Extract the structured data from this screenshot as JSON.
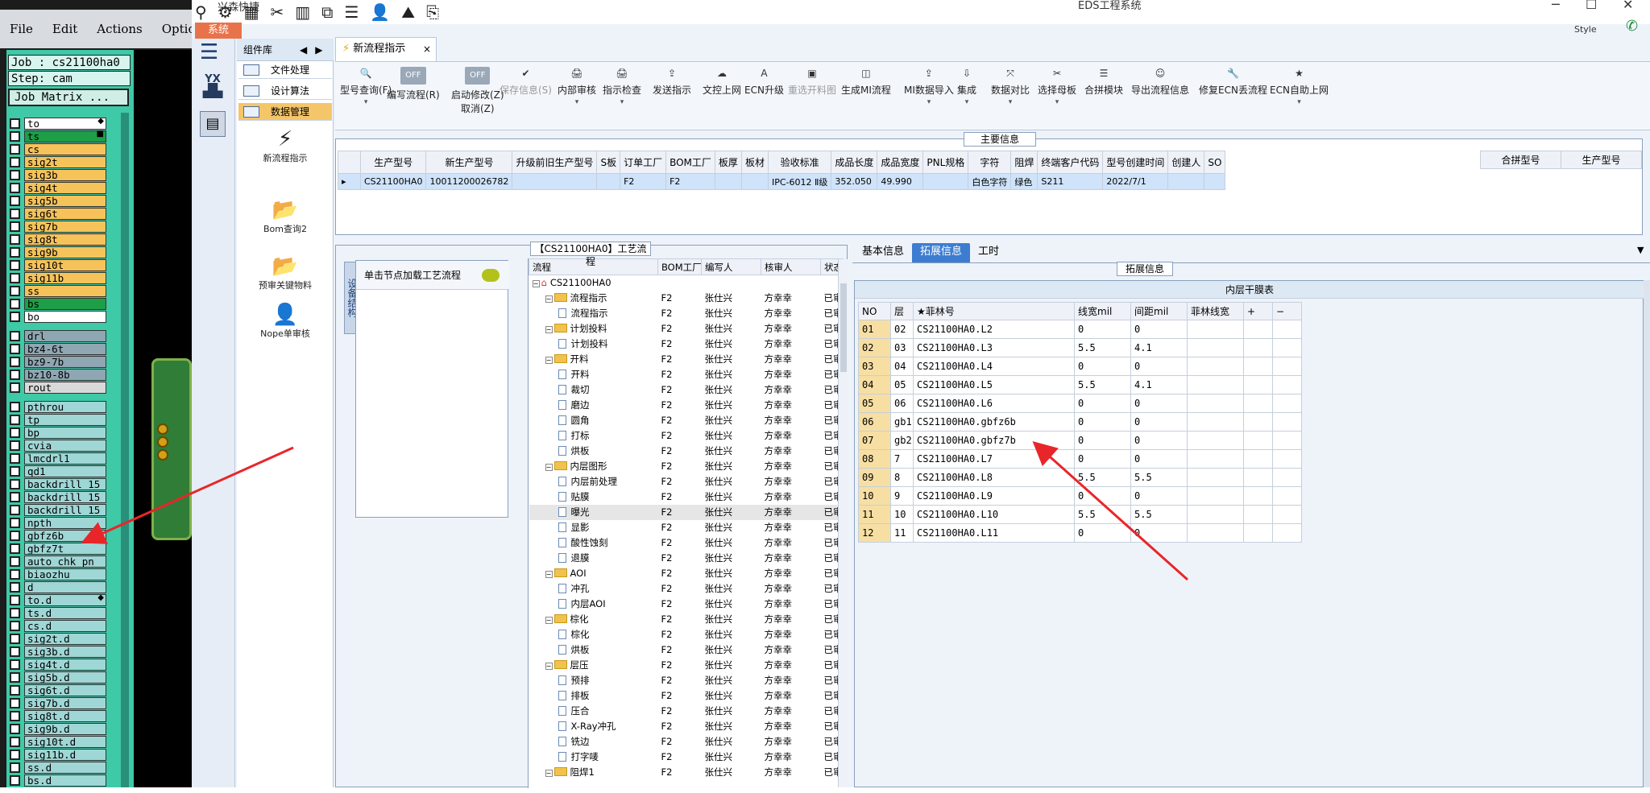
{
  "cam": {
    "menu": [
      "File",
      "Edit",
      "Actions",
      "Options"
    ],
    "job_line": "Job : cs21100ha0",
    "step_line": "Step: cam",
    "matrix_button": "Job Matrix ...",
    "layers_a": [
      {
        "name": "to",
        "color": "#ffffff",
        "mark": "◆"
      },
      {
        "name": "ts",
        "color": "#1e9e46",
        "mark": "■"
      },
      {
        "name": "cs",
        "color": "#f5c35a"
      },
      {
        "name": "sig2t",
        "color": "#f5c35a"
      },
      {
        "name": "sig3b",
        "color": "#f5c35a"
      },
      {
        "name": "sig4t",
        "color": "#f5c35a"
      },
      {
        "name": "sig5b",
        "color": "#f5c35a"
      },
      {
        "name": "sig6t",
        "color": "#f5c35a"
      },
      {
        "name": "sig7b",
        "color": "#f5c35a"
      },
      {
        "name": "sig8t",
        "color": "#f5c35a"
      },
      {
        "name": "sig9b",
        "color": "#f5c35a"
      },
      {
        "name": "sig10t",
        "color": "#f5c35a"
      },
      {
        "name": "sig11b",
        "color": "#f5c35a"
      },
      {
        "name": "ss",
        "color": "#f5c35a"
      },
      {
        "name": "bs",
        "color": "#1e9e46"
      },
      {
        "name": "bo",
        "color": "#ffffff"
      }
    ],
    "layers_b": [
      {
        "name": "drl",
        "color": "#8fa6b3"
      },
      {
        "name": "bz4-6t",
        "color": "#8fa6b3"
      },
      {
        "name": "bz9-7b",
        "color": "#8fa6b3"
      },
      {
        "name": "bz10-8b",
        "color": "#8fa6b3"
      },
      {
        "name": "rout",
        "color": "#d9d9d9"
      }
    ],
    "layers_c": [
      {
        "name": "pthrou",
        "color": "#9fd6d6"
      },
      {
        "name": "tp",
        "color": "#9fd6d6"
      },
      {
        "name": "bp",
        "color": "#9fd6d6"
      },
      {
        "name": "cvia",
        "color": "#9fd6d6"
      },
      {
        "name": "lmcdrl1",
        "color": "#9fd6d6"
      },
      {
        "name": "qd1",
        "color": "#9fd6d6"
      },
      {
        "name": "backdrill_15",
        "color": "#9fd6d6"
      },
      {
        "name": "backdrill_15",
        "color": "#9fd6d6"
      },
      {
        "name": "backdrill_15",
        "color": "#9fd6d6"
      },
      {
        "name": "npth",
        "color": "#9fd6d6"
      },
      {
        "name": "gbfz6b",
        "color": "#9fd6d6"
      },
      {
        "name": "gbfz7t",
        "color": "#9fd6d6"
      },
      {
        "name": "auto_chk_pn",
        "color": "#9fd6d6"
      },
      {
        "name": "biaozhu",
        "color": "#9fd6d6"
      },
      {
        "name": "d",
        "color": "#9fd6d6"
      },
      {
        "name": "to.d",
        "color": "#9fd6d6",
        "mark": "◆"
      },
      {
        "name": "ts.d",
        "color": "#9fd6d6"
      },
      {
        "name": "cs.d",
        "color": "#9fd6d6"
      },
      {
        "name": "sig2t.d",
        "color": "#9fd6d6"
      },
      {
        "name": "sig3b.d",
        "color": "#9fd6d6"
      },
      {
        "name": "sig4t.d",
        "color": "#9fd6d6"
      },
      {
        "name": "sig5b.d",
        "color": "#9fd6d6"
      },
      {
        "name": "sig6t.d",
        "color": "#9fd6d6"
      },
      {
        "name": "sig7b.d",
        "color": "#9fd6d6"
      },
      {
        "name": "sig8t.d",
        "color": "#9fd6d6"
      },
      {
        "name": "sig9b.d",
        "color": "#9fd6d6"
      },
      {
        "name": "sig10t.d",
        "color": "#9fd6d6"
      },
      {
        "name": "sig11b.d",
        "color": "#9fd6d6"
      },
      {
        "name": "ss.d",
        "color": "#9fd6d6"
      },
      {
        "name": "bs.d",
        "color": "#9fd6d6"
      }
    ]
  },
  "window": {
    "title": "EDS工程系统",
    "quick_name": "兴森快捷",
    "system_tab": "系统",
    "style_label": "Style"
  },
  "nav": {
    "logo_text": "YX",
    "component_header": "组件库",
    "items": [
      {
        "label": "文件处理",
        "selected": false
      },
      {
        "label": "设计算法",
        "selected": false
      },
      {
        "label": "数据管理",
        "selected": true
      }
    ],
    "big_icons": [
      {
        "label": "新流程指示",
        "icon": "⚡"
      },
      {
        "label": "Bom查询2",
        "icon": "📂"
      },
      {
        "label": "预审关键物料",
        "icon": "📂"
      },
      {
        "label": "Nope单审核",
        "icon": "👤"
      }
    ]
  },
  "ribbon": {
    "tab_label": "新流程指示",
    "close": "×",
    "toggle_off": "OFF",
    "buttons": [
      {
        "label": "型号查询(F)",
        "icon": "🔍",
        "dd": true,
        "disabled": false
      },
      {
        "label": "编写流程(R)",
        "icon": "",
        "dd": false,
        "disabled": false,
        "toggle": true
      },
      {
        "label": "启动修改(Z)",
        "label2": "取消(Z)",
        "icon": "",
        "dd": false,
        "disabled": false,
        "toggle": true
      },
      {
        "label": "保存信息(S)",
        "icon": "✔",
        "dd": false,
        "disabled": true
      },
      {
        "label": "内部审核",
        "icon": "🖨",
        "dd": true,
        "disabled": false
      },
      {
        "label": "指示检查",
        "icon": "🖨",
        "dd": true,
        "disabled": false
      },
      {
        "label": "发送指示",
        "icon": "⇪",
        "dd": false,
        "disabled": false
      },
      {
        "label": "文控上网",
        "icon": "☁",
        "dd": false,
        "disabled": false
      },
      {
        "label": "ECN升级",
        "icon": "A",
        "dd": false,
        "disabled": false
      },
      {
        "label": "重选开料图",
        "icon": "▣",
        "dd": false,
        "disabled": true
      },
      {
        "label": "生成MI流程",
        "icon": "◫",
        "dd": false,
        "disabled": false
      },
      {
        "label": "MI数据导入",
        "icon": "⇪",
        "dd": true,
        "disabled": false
      },
      {
        "label": "集成",
        "icon": "⇩",
        "dd": true,
        "disabled": false
      },
      {
        "label": "数据对比",
        "icon": "⤧",
        "dd": true,
        "disabled": false
      },
      {
        "label": "选择母板",
        "icon": "✂",
        "dd": true,
        "disabled": false
      },
      {
        "label": "合拼模块",
        "icon": "☰",
        "dd": false,
        "disabled": false
      },
      {
        "label": "导出流程信息",
        "icon": "☺",
        "dd": false,
        "disabled": false
      },
      {
        "label": "修复ECN丢流程",
        "icon": "🔧",
        "dd": false,
        "disabled": false
      },
      {
        "label": "ECN自助上网",
        "icon": "★",
        "dd": true,
        "disabled": false
      }
    ]
  },
  "main_info": {
    "title": "主要信息",
    "columns": [
      "生产型号",
      "新生产型号",
      "升级前旧生产型号",
      "S板",
      "订单工厂",
      "BOM工厂",
      "板厚",
      "板材",
      "验收标准",
      "成品长度",
      "成品宽度",
      "PNL规格",
      "字符",
      "阻焊",
      "终端客户代码",
      "型号创建时间",
      "创建人",
      "SO"
    ],
    "row": [
      "CS21100HA0",
      "10011200026782",
      "",
      "",
      "F2",
      "F2",
      "",
      "",
      "IPC-6012 Ⅱ级",
      "352.050",
      "49.990",
      "",
      "白色字符",
      "绿色",
      "S211",
      "2022/7/1",
      "",
      ""
    ],
    "merge_columns": [
      "合拼型号",
      "生产型号"
    ]
  },
  "process": {
    "title": "【CS21100HA0】工艺流程",
    "vertical_tab": "设备结构",
    "node_header": "单击节点加载工艺流程",
    "columns": [
      "流程",
      "BOM工厂",
      "编写人",
      "核审人",
      "状态"
    ],
    "rows": [
      {
        "level": 0,
        "type": "root",
        "name": "CS21100HA0",
        "bom": "",
        "writer": "",
        "reviewer": "",
        "status": ""
      },
      {
        "level": 1,
        "type": "folder",
        "name": "流程指示",
        "bom": "F2",
        "writer": "张仕兴",
        "reviewer": "方幸幸",
        "status": "已审核"
      },
      {
        "level": 2,
        "type": "doc",
        "name": "流程指示",
        "bom": "F2",
        "writer": "张仕兴",
        "reviewer": "方幸幸",
        "status": "已审核"
      },
      {
        "level": 1,
        "type": "folder",
        "name": "计划投料",
        "bom": "F2",
        "writer": "张仕兴",
        "reviewer": "方幸幸",
        "status": "已审核"
      },
      {
        "level": 2,
        "type": "doc",
        "name": "计划投料",
        "bom": "F2",
        "writer": "张仕兴",
        "reviewer": "方幸幸",
        "status": "已审核"
      },
      {
        "level": 1,
        "type": "folder",
        "name": "开料",
        "bom": "F2",
        "writer": "张仕兴",
        "reviewer": "方幸幸",
        "status": "已审核"
      },
      {
        "level": 2,
        "type": "doc",
        "name": "开料",
        "bom": "F2",
        "writer": "张仕兴",
        "reviewer": "方幸幸",
        "status": "已审核"
      },
      {
        "level": 2,
        "type": "doc",
        "name": "裁切",
        "bom": "F2",
        "writer": "张仕兴",
        "reviewer": "方幸幸",
        "status": "已审核"
      },
      {
        "level": 2,
        "type": "doc",
        "name": "磨边",
        "bom": "F2",
        "writer": "张仕兴",
        "reviewer": "方幸幸",
        "status": "已审核"
      },
      {
        "level": 2,
        "type": "doc",
        "name": "圆角",
        "bom": "F2",
        "writer": "张仕兴",
        "reviewer": "方幸幸",
        "status": "已审核"
      },
      {
        "level": 2,
        "type": "doc",
        "name": "打标",
        "bom": "F2",
        "writer": "张仕兴",
        "reviewer": "方幸幸",
        "status": "已审核"
      },
      {
        "level": 2,
        "type": "doc",
        "name": "烘板",
        "bom": "F2",
        "writer": "张仕兴",
        "reviewer": "方幸幸",
        "status": "已审核"
      },
      {
        "level": 1,
        "type": "folder",
        "name": "内层图形",
        "bom": "F2",
        "writer": "张仕兴",
        "reviewer": "方幸幸",
        "status": "已审核"
      },
      {
        "level": 2,
        "type": "doc",
        "name": "内层前处理",
        "bom": "F2",
        "writer": "张仕兴",
        "reviewer": "方幸幸",
        "status": "已审核"
      },
      {
        "level": 2,
        "type": "doc",
        "name": "贴膜",
        "bom": "F2",
        "writer": "张仕兴",
        "reviewer": "方幸幸",
        "status": "已审核"
      },
      {
        "level": 2,
        "type": "doc",
        "name": "曝光",
        "bom": "F2",
        "writer": "张仕兴",
        "reviewer": "方幸幸",
        "status": "已审核",
        "hl": true
      },
      {
        "level": 2,
        "type": "doc",
        "name": "显影",
        "bom": "F2",
        "writer": "张仕兴",
        "reviewer": "方幸幸",
        "status": "已审核"
      },
      {
        "level": 2,
        "type": "doc",
        "name": "酸性蚀刻",
        "bom": "F2",
        "writer": "张仕兴",
        "reviewer": "方幸幸",
        "status": "已审核"
      },
      {
        "level": 2,
        "type": "doc",
        "name": "退膜",
        "bom": "F2",
        "writer": "张仕兴",
        "reviewer": "方幸幸",
        "status": "已审核"
      },
      {
        "level": 1,
        "type": "folder",
        "name": "AOI",
        "bom": "F2",
        "writer": "张仕兴",
        "reviewer": "方幸幸",
        "status": "已审核"
      },
      {
        "level": 2,
        "type": "doc",
        "name": "冲孔",
        "bom": "F2",
        "writer": "张仕兴",
        "reviewer": "方幸幸",
        "status": "已审核"
      },
      {
        "level": 2,
        "type": "doc",
        "name": "内层AOI",
        "bom": "F2",
        "writer": "张仕兴",
        "reviewer": "方幸幸",
        "status": "已审核"
      },
      {
        "level": 1,
        "type": "folder",
        "name": "棕化",
        "bom": "F2",
        "writer": "张仕兴",
        "reviewer": "方幸幸",
        "status": "已审核"
      },
      {
        "level": 2,
        "type": "doc",
        "name": "棕化",
        "bom": "F2",
        "writer": "张仕兴",
        "reviewer": "方幸幸",
        "status": "已审核"
      },
      {
        "level": 2,
        "type": "doc",
        "name": "烘板",
        "bom": "F2",
        "writer": "张仕兴",
        "reviewer": "方幸幸",
        "status": "已审核"
      },
      {
        "level": 1,
        "type": "folder",
        "name": "层压",
        "bom": "F2",
        "writer": "张仕兴",
        "reviewer": "方幸幸",
        "status": "已审核"
      },
      {
        "level": 2,
        "type": "doc",
        "name": "预排",
        "bom": "F2",
        "writer": "张仕兴",
        "reviewer": "方幸幸",
        "status": "已审核"
      },
      {
        "level": 2,
        "type": "doc",
        "name": "排板",
        "bom": "F2",
        "writer": "张仕兴",
        "reviewer": "方幸幸",
        "status": "已审核"
      },
      {
        "level": 2,
        "type": "doc",
        "name": "压合",
        "bom": "F2",
        "writer": "张仕兴",
        "reviewer": "方幸幸",
        "status": "已审核"
      },
      {
        "level": 2,
        "type": "doc",
        "name": "X-Ray冲孔",
        "bom": "F2",
        "writer": "张仕兴",
        "reviewer": "方幸幸",
        "status": "已审核"
      },
      {
        "level": 2,
        "type": "doc",
        "name": "铣边",
        "bom": "F2",
        "writer": "张仕兴",
        "reviewer": "方幸幸",
        "status": "已审核"
      },
      {
        "level": 2,
        "type": "doc",
        "name": "打字唛",
        "bom": "F2",
        "writer": "张仕兴",
        "reviewer": "方幸幸",
        "status": "已审核"
      },
      {
        "level": 1,
        "type": "folder",
        "name": "阻焊1",
        "bom": "F2",
        "writer": "张仕兴",
        "reviewer": "方幸幸",
        "status": "已审核"
      }
    ]
  },
  "info": {
    "tabs": [
      {
        "label": "基本信息",
        "active": false
      },
      {
        "label": "拓展信息",
        "active": true
      },
      {
        "label": "工时",
        "active": false
      }
    ],
    "ext_title": "拓展信息",
    "film_title": "内层干膜表",
    "columns": [
      "NO",
      "层",
      "★菲林号",
      "线宽mil",
      "间距mil",
      "菲林线宽",
      "+",
      "−"
    ],
    "rows": [
      [
        "01",
        "02",
        "CS21100HA0.L2",
        "0",
        "0",
        "",
        "",
        ""
      ],
      [
        "02",
        "03",
        "CS21100HA0.L3",
        "5.5",
        "4.1",
        "",
        "",
        ""
      ],
      [
        "03",
        "04",
        "CS21100HA0.L4",
        "0",
        "0",
        "",
        "",
        ""
      ],
      [
        "04",
        "05",
        "CS21100HA0.L5",
        "5.5",
        "4.1",
        "",
        "",
        ""
      ],
      [
        "05",
        "06",
        "CS21100HA0.L6",
        "0",
        "0",
        "",
        "",
        ""
      ],
      [
        "06",
        "gb1",
        "CS21100HA0.gbfz6b",
        "0",
        "0",
        "",
        "",
        ""
      ],
      [
        "07",
        "gb2",
        "CS21100HA0.gbfz7b",
        "0",
        "0",
        "",
        "",
        ""
      ],
      [
        "08",
        "7",
        "CS21100HA0.L7",
        "0",
        "0",
        "",
        "",
        ""
      ],
      [
        "09",
        "8",
        "CS21100HA0.L8",
        "5.5",
        "5.5",
        "",
        "",
        ""
      ],
      [
        "10",
        "9",
        "CS21100HA0.L9",
        "0",
        "0",
        "",
        "",
        ""
      ],
      [
        "11",
        "10",
        "CS21100HA0.L10",
        "5.5",
        "5.5",
        "",
        "",
        ""
      ],
      [
        "12",
        "11",
        "CS21100HA0.L11",
        "0",
        "0",
        "",
        "",
        ""
      ]
    ]
  }
}
